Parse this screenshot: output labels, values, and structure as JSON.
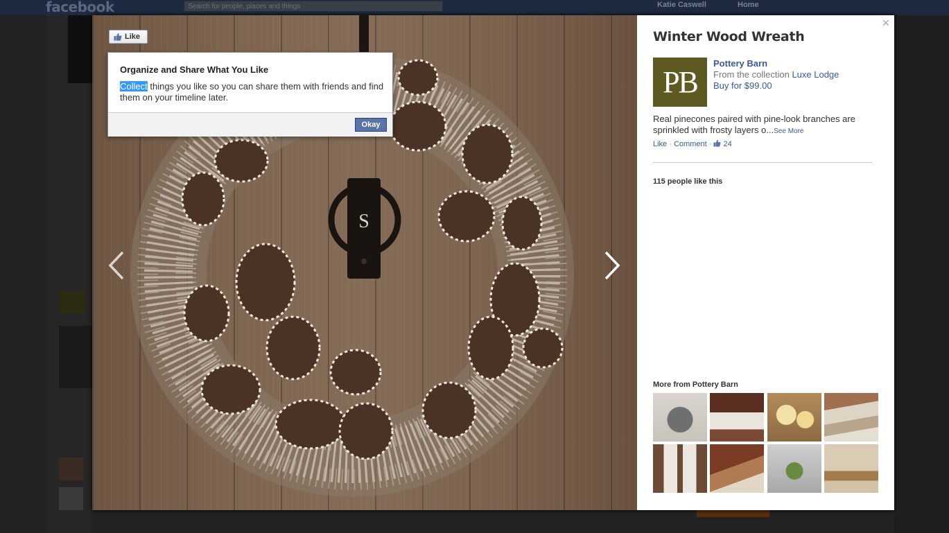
{
  "background": {
    "logo": "facebook",
    "search_placeholder": "Search for people, places and things",
    "user_name": "Katie Caswell",
    "home_label": "Home"
  },
  "viewer": {
    "like_button_label": "Like",
    "close_icon": "close-icon",
    "prev_icon": "chevron-left-icon",
    "next_icon": "chevron-right-icon"
  },
  "popup": {
    "title": "Organize and Share What You Like",
    "body_highlight": "Collect",
    "body_rest": " things you like so you can share them with friends and find them on your timeline later.",
    "okay_label": "Okay"
  },
  "product": {
    "title": "Winter Wood Wreath",
    "logo_text": "PB",
    "seller": "Pottery Barn",
    "collection_prefix": "From the collection ",
    "collection_name": "Luxe Lodge",
    "price": "Buy for $99.00",
    "description": "Real pinecones paired with pine-look branches are sprinkled with frosty layers o...",
    "see_more": "See More",
    "action_like": "Like",
    "action_comment": "Comment",
    "like_count": "24",
    "people_like": "115 people like this",
    "more_from": "More from Pottery Barn"
  },
  "colors": {
    "fb_blue": "#3b5998",
    "pb_green": "#5e5a21",
    "okay_button": "#5b74a8",
    "selection": "#3399ff"
  }
}
